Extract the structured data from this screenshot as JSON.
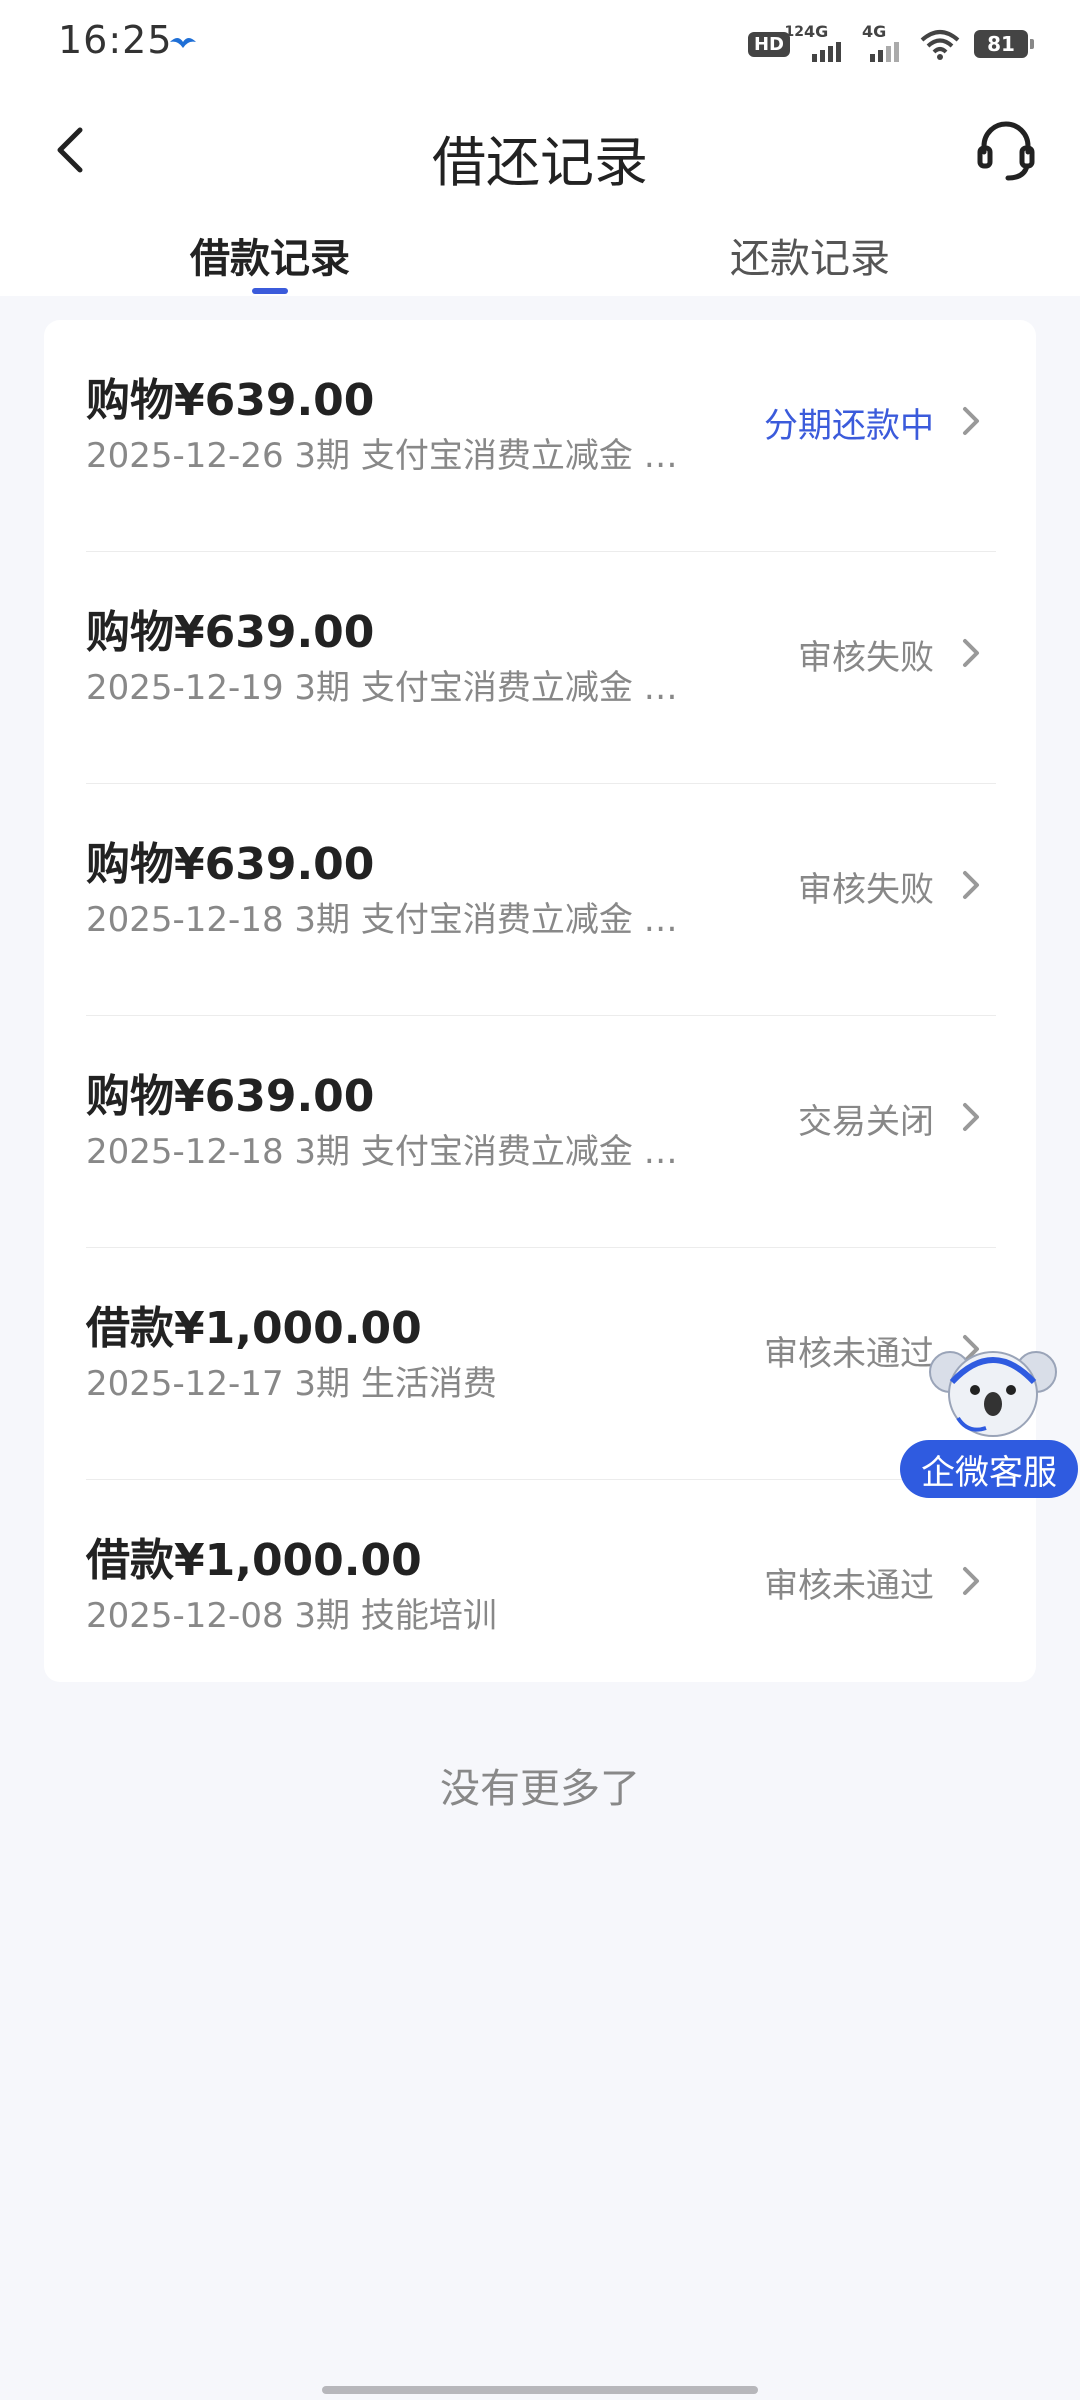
{
  "status_bar": {
    "time": "16:25",
    "hd_label": "HD",
    "hd_sub": "12",
    "signal1_label": "4G",
    "signal2_label": "4G",
    "battery": "81"
  },
  "nav": {
    "title": "借还记录",
    "back_icon": "chevron-left-icon",
    "service_icon": "headset-icon"
  },
  "tabs": [
    {
      "label": "借款记录",
      "active": true
    },
    {
      "label": "还款记录",
      "active": false
    }
  ],
  "records": [
    {
      "title": "购物¥639.00",
      "subtitle": "2025-12-26 3期  支付宝消费立减金 …",
      "status": "分期还款中",
      "status_color": "#3b5bdb"
    },
    {
      "title": "购物¥639.00",
      "subtitle": "2025-12-19 3期  支付宝消费立减金 …",
      "status": "审核失败",
      "status_color": "#888888"
    },
    {
      "title": "购物¥639.00",
      "subtitle": "2025-12-18 3期  支付宝消费立减金 …",
      "status": "审核失败",
      "status_color": "#888888"
    },
    {
      "title": "购物¥639.00",
      "subtitle": "2025-12-18 3期  支付宝消费立减金 …",
      "status": "交易关闭",
      "status_color": "#888888"
    },
    {
      "title": "借款¥1,000.00",
      "subtitle": "2025-12-17 3期  生活消费",
      "status": "审核未通过",
      "status_color": "#888888"
    },
    {
      "title": "借款¥1,000.00",
      "subtitle": "2025-12-08 3期  技能培训",
      "status": "审核未通过",
      "status_color": "#888888"
    }
  ],
  "footer": {
    "no_more": "没有更多了"
  },
  "floating_service": {
    "label": "企微客服",
    "icon": "koala-mascot-icon"
  },
  "colors": {
    "accent": "#3b5bdb",
    "background": "#f6f7fb"
  }
}
